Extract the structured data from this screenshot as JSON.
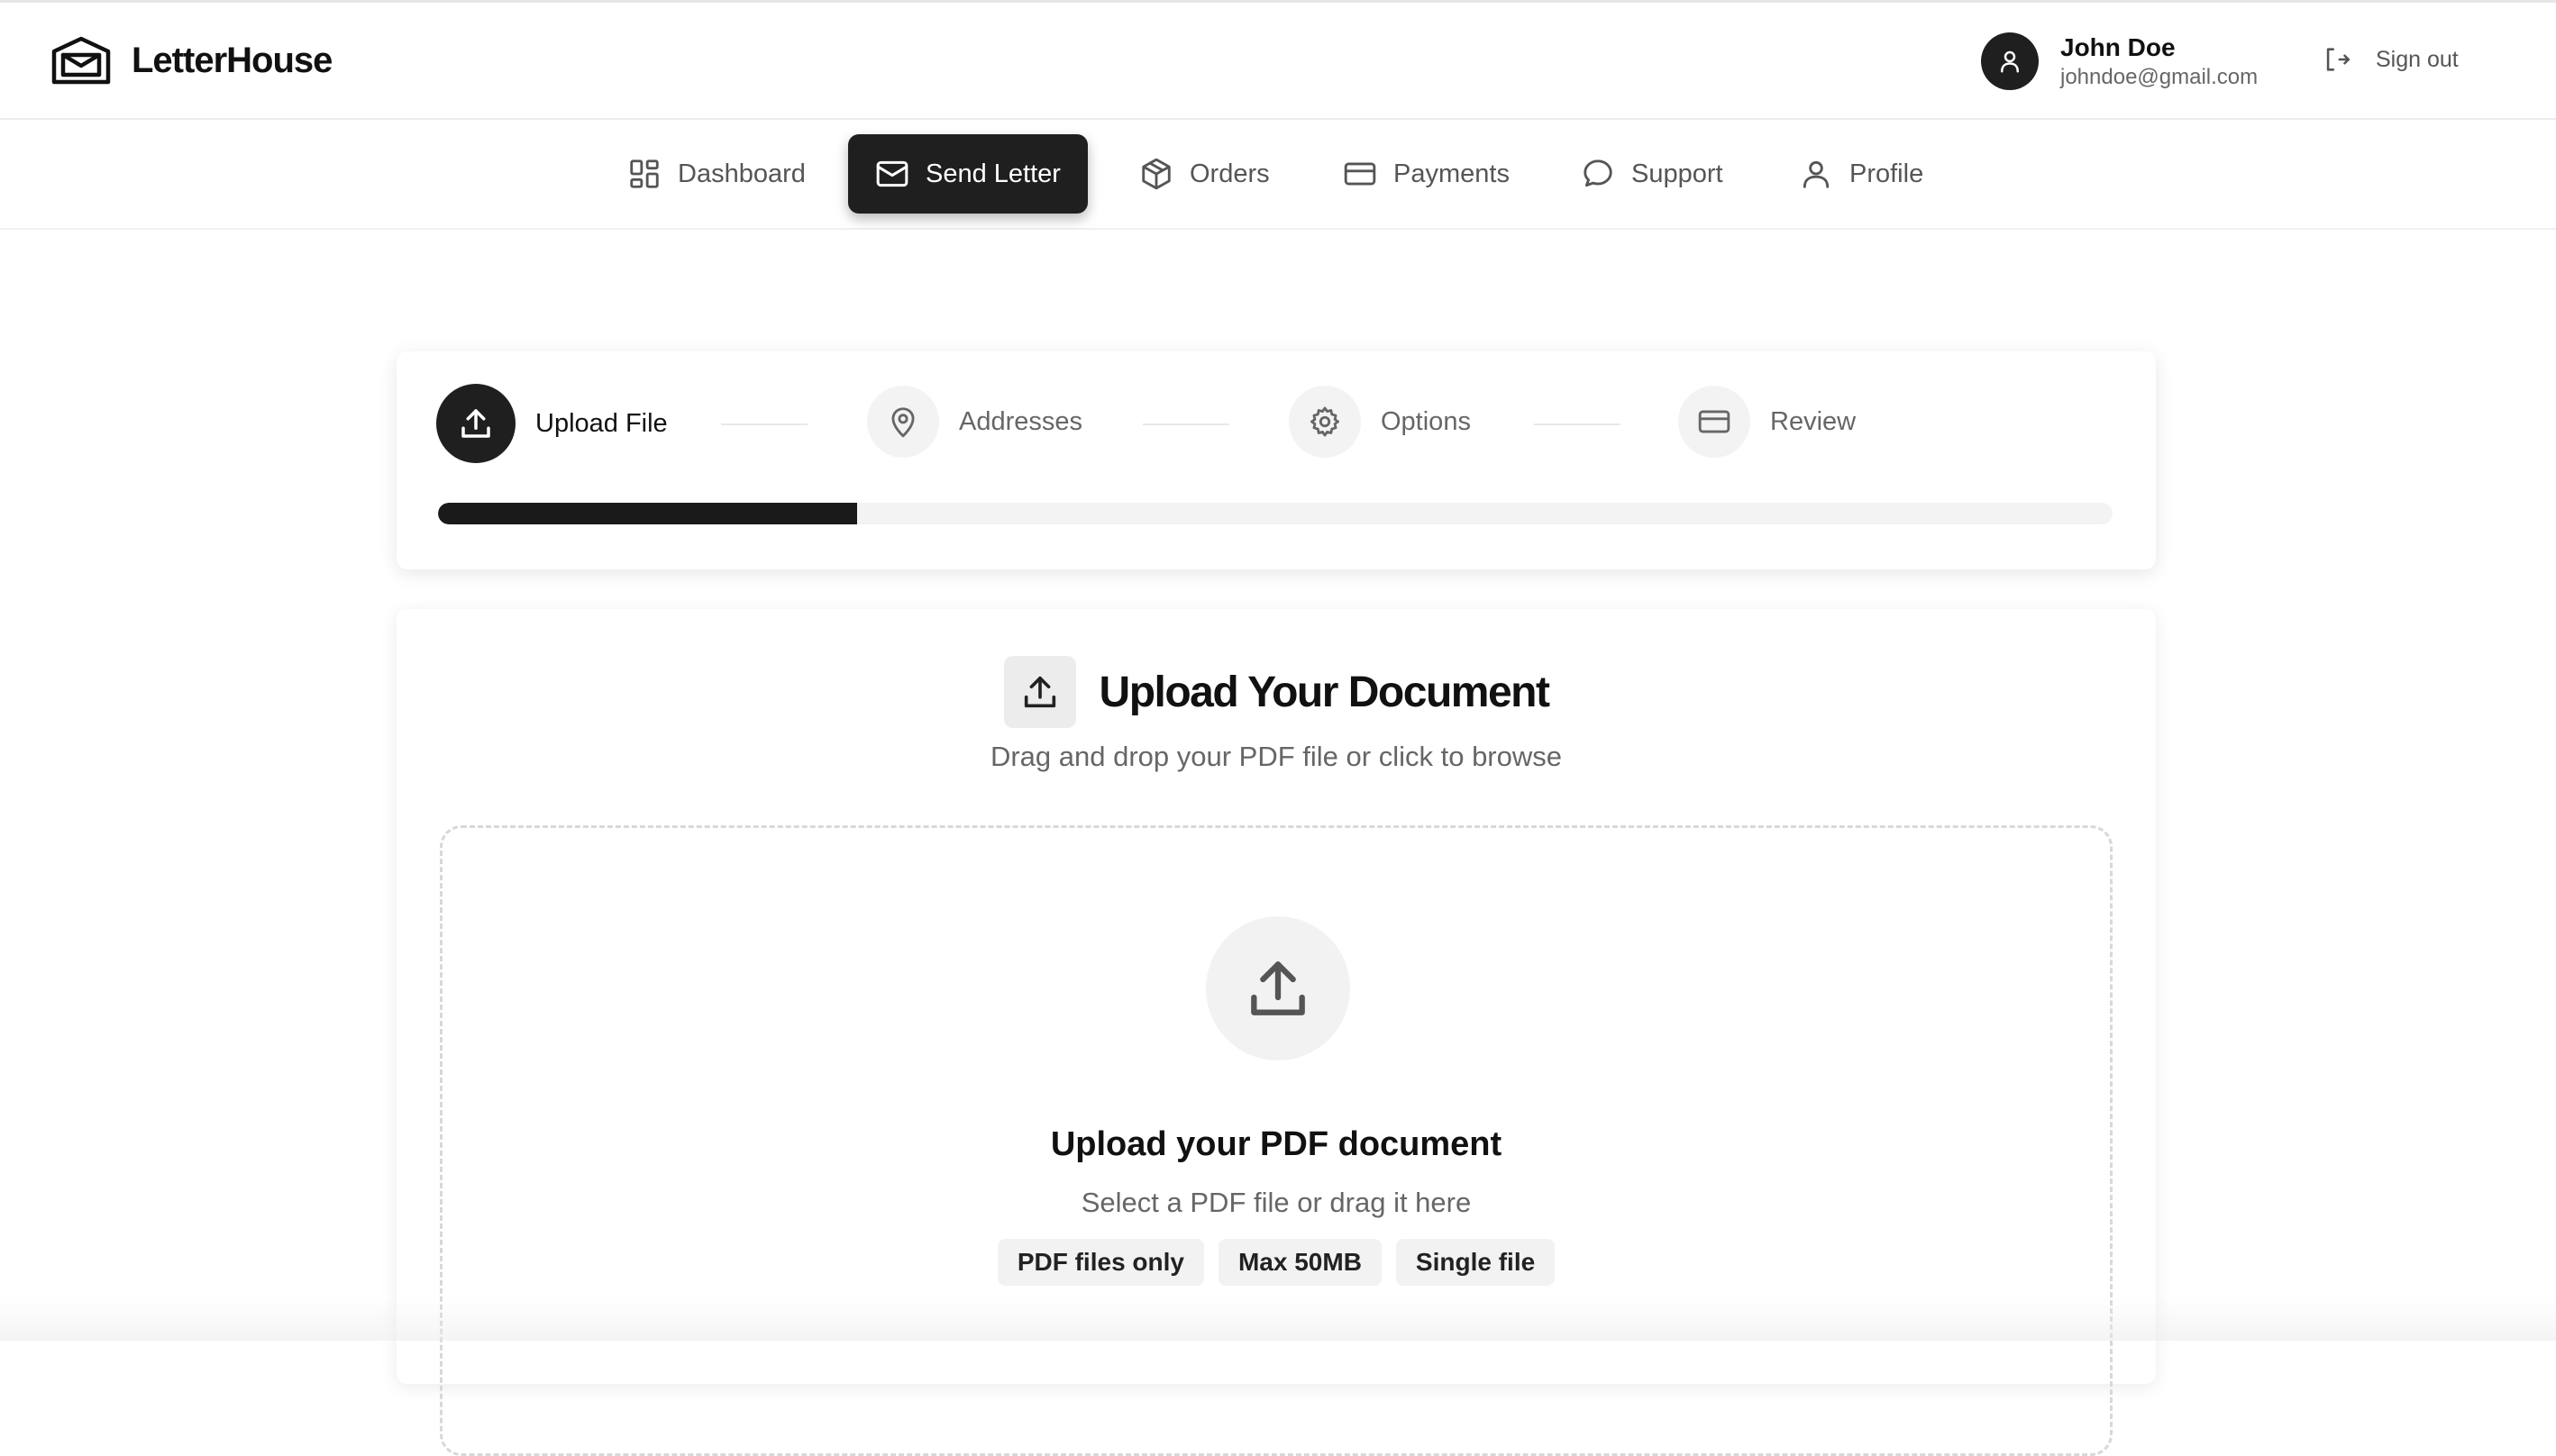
{
  "app": {
    "name": "LetterHouse"
  },
  "user": {
    "name": "John Doe",
    "email": "johndoe@gmail.com",
    "sign_out_label": "Sign out"
  },
  "nav": {
    "items": [
      {
        "label": "Dashboard",
        "icon": "dashboard-icon",
        "active": false
      },
      {
        "label": "Send Letter",
        "icon": "mail-icon",
        "active": true
      },
      {
        "label": "Orders",
        "icon": "package-icon",
        "active": false
      },
      {
        "label": "Payments",
        "icon": "credit-card-icon",
        "active": false
      },
      {
        "label": "Support",
        "icon": "chat-bubble-icon",
        "active": false
      },
      {
        "label": "Profile",
        "icon": "user-icon",
        "active": false
      }
    ]
  },
  "stepper": {
    "steps": [
      {
        "label": "Upload File",
        "icon": "upload-icon",
        "active": true
      },
      {
        "label": "Addresses",
        "icon": "map-pin-icon",
        "active": false
      },
      {
        "label": "Options",
        "icon": "gear-icon",
        "active": false
      },
      {
        "label": "Review",
        "icon": "credit-card-icon",
        "active": false
      }
    ],
    "progress_percent": 25
  },
  "upload": {
    "title": "Upload Your Document",
    "subtitle": "Drag and drop your PDF file or click to browse",
    "dropzone": {
      "title": "Upload your PDF document",
      "subtitle": "Select a PDF file or drag it here",
      "badges": [
        "PDF files only",
        "Max 50MB",
        "Single file"
      ]
    }
  },
  "colors": {
    "primary": "#1f1f1f",
    "text_muted": "#666666",
    "border": "#d8d8d8",
    "surface_muted": "#f2f2f2"
  }
}
